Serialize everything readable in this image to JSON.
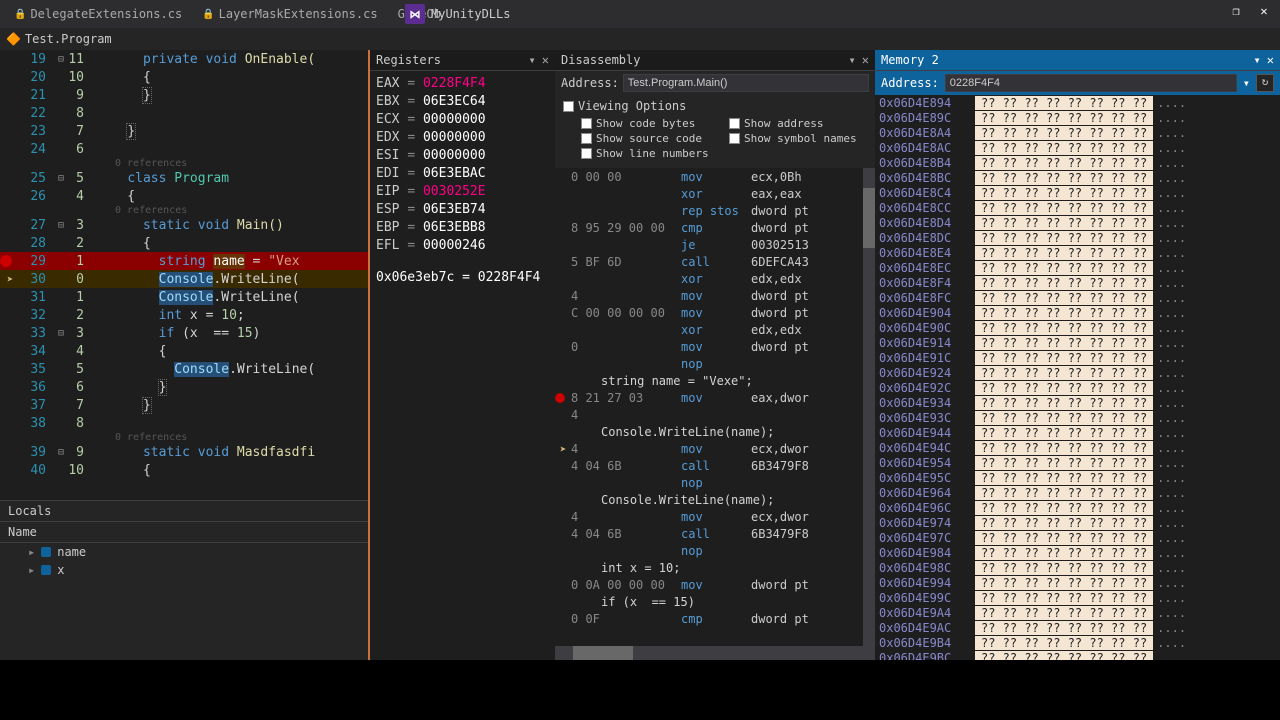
{
  "tabs": [
    {
      "name": "DelegateExtensions.cs",
      "locked": true
    },
    {
      "name": "LayerMaskExtensions.cs",
      "locked": true
    },
    {
      "name": "GameOb"
    }
  ],
  "app_title": "MyUnityDLLs",
  "breadcrumb": "Test.Program",
  "code": [
    {
      "n": 19,
      "n2": 11,
      "fold": "⊟",
      "txt": "private void OnEnable(",
      "cls": "kw-mth"
    },
    {
      "n": 20,
      "n2": 10,
      "txt": "{"
    },
    {
      "n": 21,
      "n2": 9,
      "txt": "}",
      "brace": true
    },
    {
      "n": 22,
      "n2": 8,
      "txt": ""
    },
    {
      "n": 23,
      "n2": 7,
      "txt": "}",
      "brace": true
    },
    {
      "n": 24,
      "n2": 6,
      "txt": ""
    },
    {
      "ref": "0 references"
    },
    {
      "n": 25,
      "n2": 5,
      "fold": "⊟",
      "txt": "class Program",
      "cls": "kw-ty"
    },
    {
      "n": 26,
      "n2": 4,
      "txt": "{"
    },
    {
      "ref": "0 references"
    },
    {
      "n": 27,
      "n2": 3,
      "fold": "⊟",
      "txt": "static void Main()",
      "cls": "kw-mth"
    },
    {
      "n": 28,
      "n2": 2,
      "txt": "{"
    },
    {
      "n": 29,
      "n2": 1,
      "bp": true,
      "hl": "brk",
      "txt": "string name = \"Vex",
      "cls": "str-line"
    },
    {
      "n": 30,
      "n2": 0,
      "ar": true,
      "hl": "cur",
      "txt": "Console.WriteLine(",
      "cls": "console"
    },
    {
      "n": 31,
      "n2": 1,
      "txt": "Console.WriteLine(",
      "cls": "console"
    },
    {
      "n": 32,
      "n2": 2,
      "txt": "int x = 10;",
      "cls": "int-line"
    },
    {
      "n": 33,
      "n2": 3,
      "fold": "⊟",
      "txt": "if (x  == 15)",
      "cls": "if-line"
    },
    {
      "n": 34,
      "n2": 4,
      "txt": "{"
    },
    {
      "n": 35,
      "n2": 5,
      "txt": "Console.WriteL",
      "cls": "console"
    },
    {
      "n": 36,
      "n2": 6,
      "txt": "}",
      "brace": true
    },
    {
      "n": 37,
      "n2": 7,
      "txt": "}",
      "brace": true
    },
    {
      "n": 38,
      "n2": 8,
      "txt": ""
    },
    {
      "ref": "0 references"
    },
    {
      "n": 39,
      "n2": 9,
      "fold": "⊟",
      "txt": "static void Masdfasdfi",
      "cls": "kw-mth"
    },
    {
      "n": 40,
      "n2": 10,
      "txt": "{"
    }
  ],
  "locals": {
    "title": "Locals",
    "col": "Name",
    "vars": [
      {
        "name": "name"
      },
      {
        "name": "x"
      }
    ]
  },
  "registers": {
    "title": "Registers",
    "regs": [
      {
        "r": "EAX",
        "v": "0228F4F4",
        "hot": true
      },
      {
        "r": "EBX",
        "v": "06E3EC64"
      },
      {
        "r": "ECX",
        "v": "00000000"
      },
      {
        "r": "EDX",
        "v": "00000000"
      },
      {
        "r": "ESI",
        "v": "00000000"
      },
      {
        "r": "EDI",
        "v": "06E3EBAC"
      },
      {
        "r": "EIP",
        "v": "0030252E",
        "hot": true
      },
      {
        "r": "ESP",
        "v": "06E3EB74"
      },
      {
        "r": "EBP",
        "v": "06E3EBB8"
      },
      {
        "r": "EFL",
        "v": "00000246"
      }
    ],
    "extra": "0x06e3eb7c = 0228F4F4"
  },
  "disasm": {
    "title": "Disassembly",
    "addr_label": "Address:",
    "addr_value": "Test.Program.Main()",
    "opts_title": "Viewing Options",
    "opts": [
      {
        "l": "Show code bytes"
      },
      {
        "l": "Show address"
      },
      {
        "l": "Show source code"
      },
      {
        "l": "Show symbol names"
      },
      {
        "l": "Show line numbers"
      }
    ],
    "lines": [
      {
        "b": "0 00 00",
        "m": "mov",
        "o": "ecx,0Bh"
      },
      {
        "b": "",
        "m": "xor",
        "o": "eax,eax"
      },
      {
        "b": "",
        "m": "rep stos",
        "o": "dword pt"
      },
      {
        "b": "8 95 29 00 00",
        "m": "cmp",
        "o": "dword pt"
      },
      {
        "b": "",
        "m": "je",
        "o": "00302513"
      },
      {
        "b": "5 BF 6D",
        "m": "call",
        "o": "6DEFCA43"
      },
      {
        "b": "",
        "m": "xor",
        "o": "edx,edx"
      },
      {
        "b": "4",
        "m": "mov",
        "o": "dword pt"
      },
      {
        "b": "C 00 00 00 00",
        "m": "mov",
        "o": "dword pt"
      },
      {
        "b": "",
        "m": "xor",
        "o": "edx,edx"
      },
      {
        "b": "0",
        "m": "mov",
        "o": "dword pt"
      },
      {
        "b": "",
        "m": "nop",
        "o": ""
      },
      {
        "src": "string name = \"Vexe\";"
      },
      {
        "bp": true,
        "b": "8 21 27 03",
        "m": "mov",
        "o": "eax,dwor"
      },
      {
        "b": "4",
        "m": "",
        "o": ""
      },
      {
        "src": "Console.WriteLine(name);"
      },
      {
        "ar": true,
        "b": "4",
        "m": "mov",
        "o": "ecx,dwor"
      },
      {
        "b": "4 04 6B",
        "m": "call",
        "o": "6B3479F8"
      },
      {
        "b": "",
        "m": "nop",
        "o": ""
      },
      {
        "src": "Console.WriteLine(name);"
      },
      {
        "b": "4",
        "m": "mov",
        "o": "ecx,dwor"
      },
      {
        "b": "4 04 6B",
        "m": "call",
        "o": "6B3479F8"
      },
      {
        "b": "",
        "m": "nop",
        "o": ""
      },
      {
        "src": "int x = 10;"
      },
      {
        "b": "0 0A 00 00 00",
        "m": "mov",
        "o": "dword pt"
      },
      {
        "src": "if (x  == 15)"
      },
      {
        "b": "0 0F",
        "m": "cmp",
        "o": "dword pt"
      }
    ]
  },
  "memory": {
    "title": "Memory 2",
    "addr_label": "Address:",
    "addr_value": "0228F4F4",
    "base": "0x06D4E894",
    "rows": 39,
    "bytes": "?? ?? ?? ?? ?? ?? ?? ??",
    "txt": "...."
  }
}
